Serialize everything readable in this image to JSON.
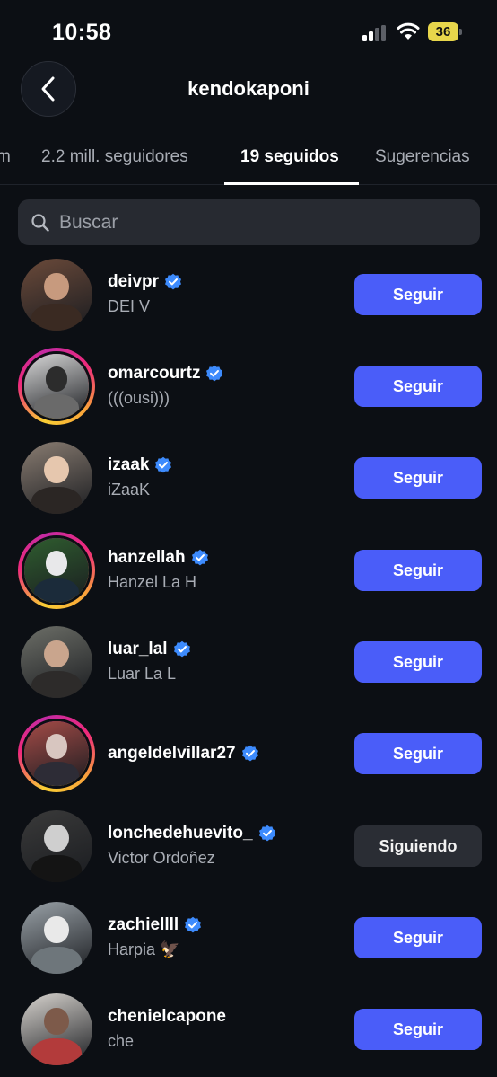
{
  "status_bar": {
    "time": "10:58",
    "battery": "36"
  },
  "header": {
    "title": "kendokaponi"
  },
  "tabs": [
    {
      "label": "m"
    },
    {
      "label": "2.2 mill. seguidores"
    },
    {
      "label": "19 seguidos"
    },
    {
      "label": "Sugerencias"
    }
  ],
  "search": {
    "placeholder": "Buscar"
  },
  "colors": {
    "accent": "#4a5df9",
    "verified": "#3d8bfd",
    "background": "#0c0f14"
  },
  "accounts": [
    {
      "username": "deivpr",
      "fullname": "DEI V",
      "verified": true,
      "story": false,
      "action": "Seguir"
    },
    {
      "username": "omarcourtz",
      "fullname": "(((ousi)))",
      "verified": true,
      "story": true,
      "action": "Seguir"
    },
    {
      "username": "izaak",
      "fullname": "iZaaK",
      "verified": true,
      "story": false,
      "action": "Seguir"
    },
    {
      "username": "hanzellah",
      "fullname": "Hanzel La H",
      "verified": true,
      "story": true,
      "action": "Seguir"
    },
    {
      "username": "luar_lal",
      "fullname": "Luar La L",
      "verified": true,
      "story": false,
      "action": "Seguir"
    },
    {
      "username": "angeldelvillar27",
      "fullname": "",
      "verified": true,
      "story": true,
      "action": "Seguir"
    },
    {
      "username": "lonchedehuevito_",
      "fullname": "Victor Ordoñez",
      "verified": true,
      "story": false,
      "action": "Siguiendo"
    },
    {
      "username": "zachiellll",
      "fullname": "Harpia 🦅",
      "verified": true,
      "story": false,
      "action": "Seguir"
    },
    {
      "username": "chenielcapone",
      "fullname": "che",
      "verified": false,
      "story": false,
      "action": "Seguir"
    }
  ]
}
